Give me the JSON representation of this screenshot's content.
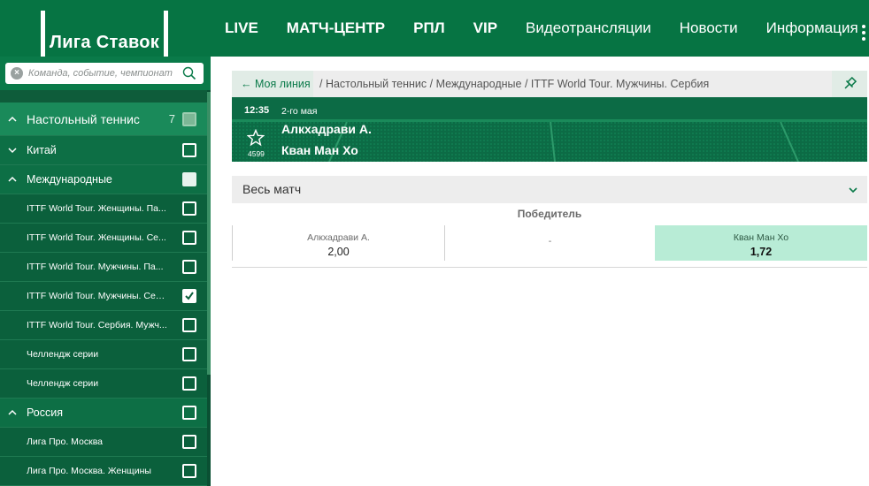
{
  "header": {
    "logo_text": "Лига Ставок",
    "nav": [
      "LIVE",
      "МАТЧ-ЦЕНТР",
      "РПЛ",
      "VIP",
      "Видеотрансляции",
      "Новости",
      "Информация"
    ]
  },
  "sidebar": {
    "search_placeholder": "Команда, событие, чемпионат",
    "sport": {
      "label": "Настольный теннис",
      "count": "7"
    },
    "items": [
      {
        "label": "Китай"
      },
      {
        "label": "Международные"
      },
      {
        "label": "ITTF World Tour. Женщины. Па..."
      },
      {
        "label": "ITTF World Tour. Женщины. Се..."
      },
      {
        "label": "ITTF World Tour. Мужчины. Па..."
      },
      {
        "label": "ITTF World Tour. Мужчины. Сер..."
      },
      {
        "label": "ITTF World Tour. Сербия. Мужч..."
      },
      {
        "label": "Челлендж серии"
      },
      {
        "label": "Челлендж серии"
      },
      {
        "label": "Россия"
      },
      {
        "label": "Лига Про. Москва"
      },
      {
        "label": "Лига Про. Москва. Женщины"
      }
    ]
  },
  "breadcrumb": {
    "back_label": "← Моя линия",
    "path": "/ Настольный теннис / Международные / ITTF World Tour. Мужчины. Сербия"
  },
  "event": {
    "time": "12:35",
    "date": "2-го мая",
    "team1": "Алкхадрави А.",
    "team2": "Кван Ман Хо",
    "id": "4599"
  },
  "market": {
    "label": "Весь матч",
    "outcome_title": "Победитель",
    "odds": [
      {
        "name": "Алкхадрави А.",
        "value": "2,00"
      },
      {
        "name": "-",
        "value": ""
      },
      {
        "name": "Кван Ман Хо",
        "value": "1,72"
      }
    ]
  },
  "colors": {
    "brand": "#067443",
    "sidebar": "#0e5c3a",
    "odd_highlight": "#b8ecd6"
  },
  "icons": [
    "search-icon",
    "clear-icon",
    "chevron-up-icon",
    "chevron-down-icon",
    "pin-icon",
    "star-icon",
    "more-icon",
    "checkbox-icon"
  ]
}
